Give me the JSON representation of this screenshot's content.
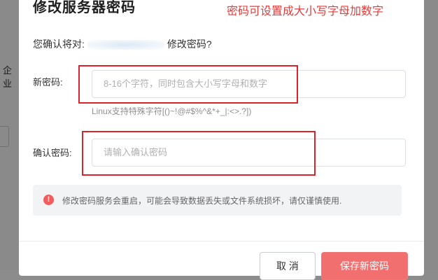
{
  "background": {
    "left_text": "企业"
  },
  "dialog": {
    "title": "修改服务器密码",
    "annotation": "密码可设置成大小写字母加数字",
    "confirm_prefix": "您确认将对:",
    "confirm_suffix": "修改密码?",
    "new_password": {
      "label": "新密码:",
      "placeholder": "8-16个字符，同时包含大小写字母和数字",
      "hint": "Linux支持特殊字符[()~!@#$%^&*+_|:<>.?])"
    },
    "confirm_password": {
      "label": "确认密码:",
      "placeholder": "请输入确认密码"
    },
    "notice": {
      "icon": "warning-icon",
      "text": "修改密码服务会重启，可能会导致数据丢失或文件系统损坏，请仅谨慎使用."
    },
    "buttons": {
      "cancel": "取 消",
      "save": "保存新密码"
    }
  },
  "colors": {
    "annotation": "#e23c3c",
    "highlight_box": "#d9232d",
    "save_button": "#f26f6f",
    "notice_icon": "#f25c5c"
  }
}
